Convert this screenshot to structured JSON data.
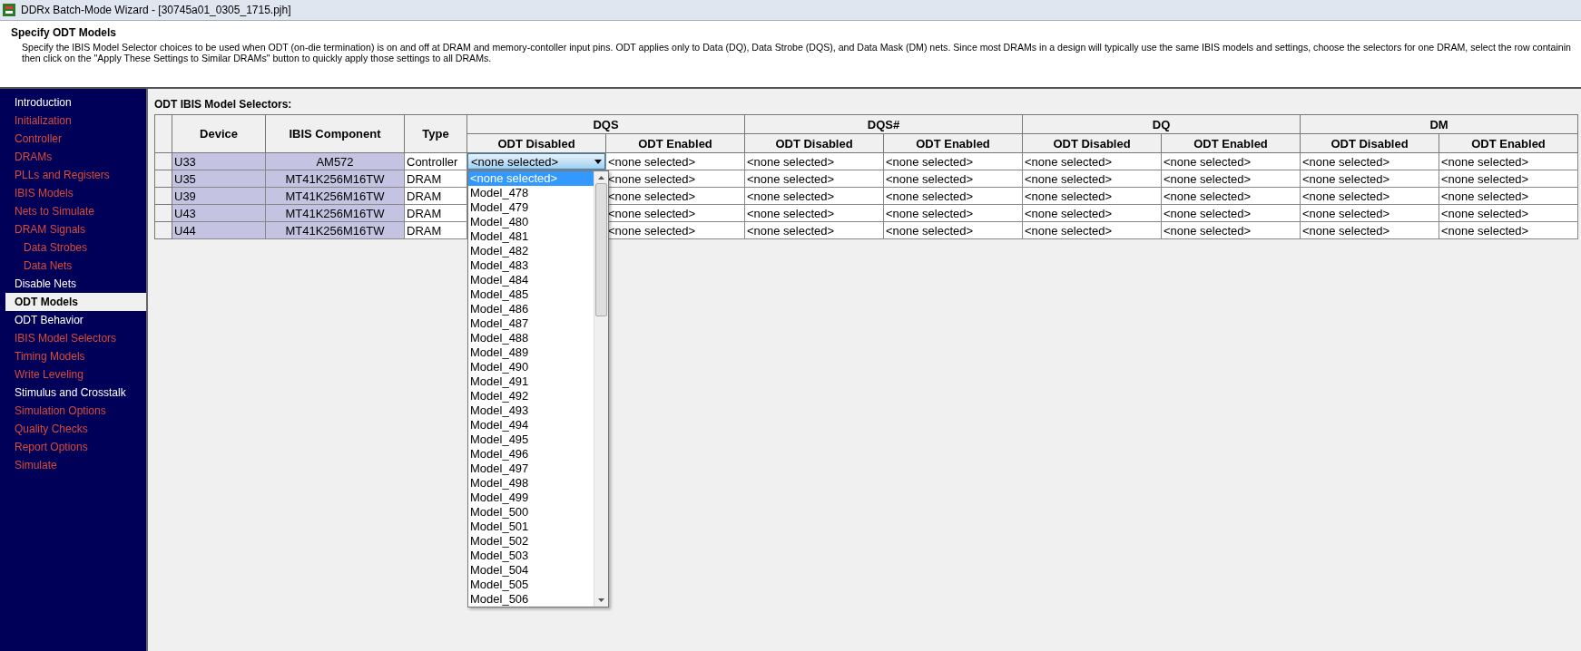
{
  "window": {
    "title": "DDRx Batch-Mode Wizard - [30745a01_0305_1715.pjh]"
  },
  "header": {
    "title": "Specify ODT Models",
    "lines": [
      "Specify the IBIS Model Selector choices to be used when ODT (on-die termination) is on and off at DRAM and memory-contoller input pins.  ODT applies only to Data (DQ), Data Strobe (DQS), and Data Mask (DM) nets.  Since most DRAMs in a design will typically use the same IBIS models and settings, choose the selectors for one DRAM, select the row containin",
      "then click on the \"Apply These Settings to Similar DRAMs\" button to quickly apply those settings to all DRAMs."
    ]
  },
  "sidebar": {
    "items": [
      {
        "label": "Introduction",
        "enabled": true,
        "selected": false
      },
      {
        "label": "Initialization",
        "enabled": false,
        "selected": false
      },
      {
        "label": "Controller",
        "enabled": false,
        "selected": false
      },
      {
        "label": "DRAMs",
        "enabled": false,
        "selected": false
      },
      {
        "label": "PLLs and Registers",
        "enabled": false,
        "selected": false
      },
      {
        "label": "IBIS Models",
        "enabled": false,
        "selected": false
      },
      {
        "label": "Nets to Simulate",
        "enabled": false,
        "selected": false
      },
      {
        "label": "DRAM Signals",
        "enabled": false,
        "selected": false,
        "children": [
          {
            "label": "Data Strobes",
            "enabled": false,
            "selected": false
          },
          {
            "label": "Data Nets",
            "enabled": false,
            "selected": false
          }
        ]
      },
      {
        "label": "Disable Nets",
        "enabled": true,
        "selected": false
      },
      {
        "label": "ODT Models",
        "enabled": true,
        "selected": true
      },
      {
        "label": "ODT Behavior",
        "enabled": true,
        "selected": false
      },
      {
        "label": "IBIS Model Selectors",
        "enabled": false,
        "selected": false
      },
      {
        "label": "Timing Models",
        "enabled": false,
        "selected": false
      },
      {
        "label": "Write Leveling",
        "enabled": false,
        "selected": false
      },
      {
        "label": "Stimulus and Crosstalk",
        "enabled": true,
        "selected": false
      },
      {
        "label": "Simulation Options",
        "enabled": false,
        "selected": false
      },
      {
        "label": "Quality Checks",
        "enabled": false,
        "selected": false
      },
      {
        "label": "Report Options",
        "enabled": false,
        "selected": false
      },
      {
        "label": "Simulate",
        "enabled": false,
        "selected": false
      }
    ]
  },
  "table": {
    "title": "ODT IBIS Model Selectors:",
    "columns": [
      "Device",
      "IBIS Component",
      "Type"
    ],
    "groups": [
      {
        "label": "DQS",
        "columns": [
          "ODT Disabled",
          "ODT Enabled"
        ]
      },
      {
        "label": "DQS#",
        "columns": [
          "ODT Disabled",
          "ODT Enabled"
        ]
      },
      {
        "label": "DQ",
        "columns": [
          "ODT Disabled",
          "ODT Enabled"
        ]
      },
      {
        "label": "DM",
        "columns": [
          "ODT Disabled",
          "ODT Enabled"
        ]
      }
    ],
    "rows": [
      {
        "device": "U33",
        "component": "AM572",
        "type": "Controller",
        "cells": [
          {
            "kind": "dropdown",
            "value": "<none selected>"
          },
          "<none selected>",
          "<none selected>",
          "<none selected>",
          "<none selected>",
          "<none selected>",
          "<none selected>",
          "<none selected>"
        ]
      },
      {
        "device": "U35",
        "component": "MT41K256M16TW",
        "type": "DRAM",
        "cells": [
          null,
          "<none selected>",
          "<none selected>",
          "<none selected>",
          "<none selected>",
          "<none selected>",
          "<none selected>",
          "<none selected>"
        ]
      },
      {
        "device": "U39",
        "component": "MT41K256M16TW",
        "type": "DRAM",
        "cells": [
          null,
          "<none selected>",
          "<none selected>",
          "<none selected>",
          "<none selected>",
          "<none selected>",
          "<none selected>",
          "<none selected>"
        ]
      },
      {
        "device": "U43",
        "component": "MT41K256M16TW",
        "type": "DRAM",
        "cells": [
          null,
          "<none selected>",
          "<none selected>",
          "<none selected>",
          "<none selected>",
          "<none selected>",
          "<none selected>",
          "<none selected>"
        ]
      },
      {
        "device": "U44",
        "component": "MT41K256M16TW",
        "type": "DRAM",
        "cells": [
          null,
          "<none selected>",
          "<none selected>",
          "<none selected>",
          "<none selected>",
          "<none selected>",
          "<none selected>",
          "<none selected>"
        ]
      }
    ],
    "dropdown": {
      "options": [
        {
          "label": "<none selected>",
          "selected": true
        },
        {
          "label": "Model_478",
          "selected": false
        },
        {
          "label": "Model_479",
          "selected": false
        },
        {
          "label": "Model_480",
          "selected": false
        },
        {
          "label": "Model_481",
          "selected": false
        },
        {
          "label": "Model_482",
          "selected": false
        },
        {
          "label": "Model_483",
          "selected": false
        },
        {
          "label": "Model_484",
          "selected": false
        },
        {
          "label": "Model_485",
          "selected": false
        },
        {
          "label": "Model_486",
          "selected": false
        },
        {
          "label": "Model_487",
          "selected": false
        },
        {
          "label": "Model_488",
          "selected": false
        },
        {
          "label": "Model_489",
          "selected": false
        },
        {
          "label": "Model_490",
          "selected": false
        },
        {
          "label": "Model_491",
          "selected": false
        },
        {
          "label": "Model_492",
          "selected": false
        },
        {
          "label": "Model_493",
          "selected": false
        },
        {
          "label": "Model_494",
          "selected": false
        },
        {
          "label": "Model_495",
          "selected": false
        },
        {
          "label": "Model_496",
          "selected": false
        },
        {
          "label": "Model_497",
          "selected": false
        },
        {
          "label": "Model_498",
          "selected": false
        },
        {
          "label": "Model_499",
          "selected": false
        },
        {
          "label": "Model_500",
          "selected": false
        },
        {
          "label": "Model_501",
          "selected": false
        },
        {
          "label": "Model_502",
          "selected": false
        },
        {
          "label": "Model_503",
          "selected": false
        },
        {
          "label": "Model_504",
          "selected": false
        },
        {
          "label": "Model_505",
          "selected": false
        },
        {
          "label": "Model_506",
          "selected": false
        }
      ]
    }
  }
}
